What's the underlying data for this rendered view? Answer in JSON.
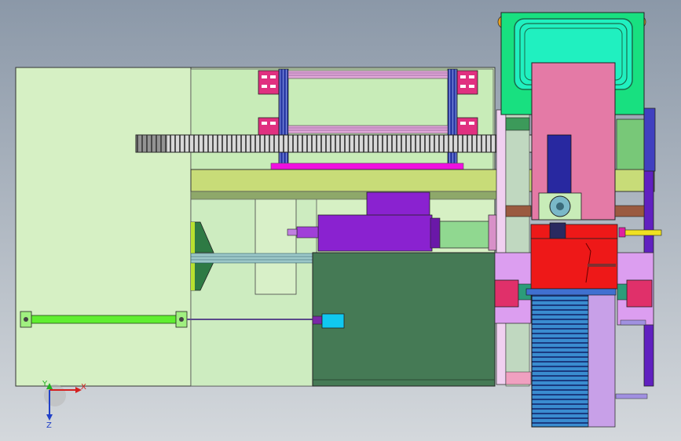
{
  "viewport": {
    "background_top": "#8b98a8",
    "background_bottom": "#d4d8dc"
  },
  "triad": {
    "x_label": "X",
    "y_label": "Y",
    "z_label": "Z",
    "x_color": "#d42020",
    "y_color": "#22b022",
    "z_color": "#2040c8"
  },
  "colors": {
    "base_plate": "#d6f0c4",
    "inner_plate": "#c8ecb8",
    "rail_beam": "#c8dc78",
    "gear_rack": "#c0c0c0",
    "rod": "#60ee30",
    "dark_housing": "#457a55",
    "motor": "#8a22d0",
    "mount_frame": "#dc9ef0",
    "pink_block": "#e47aa6",
    "top_frame": "#18e080",
    "top_cover": "#20f0c0",
    "red_carriage": "#ee1818",
    "blue_column": "#2828a0",
    "fins": "#3a8cd0",
    "clamp": "#e03080",
    "sensor": "#10c8f0",
    "magenta_strip": "#f010e0",
    "slider": "#90d890",
    "yellow_pin": "#f0e020",
    "brown_bar": "#9a5a40"
  }
}
